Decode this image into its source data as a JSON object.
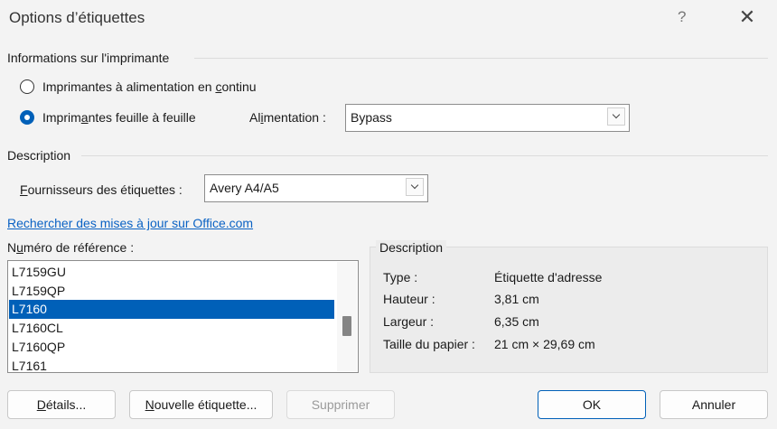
{
  "window": {
    "title": "Options d’étiquettes",
    "help": "?",
    "close": "✕"
  },
  "printer": {
    "group_label": "Informations sur l'imprimante",
    "continuous": {
      "label_a": "Imprimantes à alimentation en ",
      "key": "c",
      "label_b": "ontinu"
    },
    "sheet": {
      "label_a": "Imprim",
      "key": "a",
      "label_b": "ntes feuille à feuille"
    },
    "feed": {
      "label_a": "Al",
      "key": "i",
      "label_b": "mentation :",
      "value": "Bypass"
    }
  },
  "description": {
    "group_label": "Description",
    "vendor": {
      "key": "F",
      "label_b": "ournisseurs des étiquettes :",
      "value": "Avery A4/A5"
    }
  },
  "update_link": "Rechercher des mises à jour sur Office.com",
  "product": {
    "label_a": "N",
    "key": "u",
    "label_b": "méro de référence :",
    "items": [
      "L7159GU",
      "L7159QP",
      "L7160",
      "L7160CL",
      "L7160QP",
      "L7161"
    ],
    "selected": "L7160"
  },
  "details": {
    "title": "Description",
    "rows": [
      {
        "label": "Type :",
        "value": "Étiquette d'adresse"
      },
      {
        "label": "Hauteur :",
        "value": "3,81 cm"
      },
      {
        "label": "Largeur :",
        "value": "6,35 cm"
      },
      {
        "label": "Taille du papier :",
        "value": "21 cm × 29,69 cm"
      }
    ]
  },
  "buttons": {
    "details": {
      "key": "D",
      "label_b": "étails..."
    },
    "new_label": {
      "key": "N",
      "label_b": "ouvelle étiquette..."
    },
    "delete": "Supprimer",
    "ok": "OK",
    "cancel": "Annuler"
  },
  "colors": {
    "accent": "#0060b8",
    "link": "#0a62c4"
  }
}
